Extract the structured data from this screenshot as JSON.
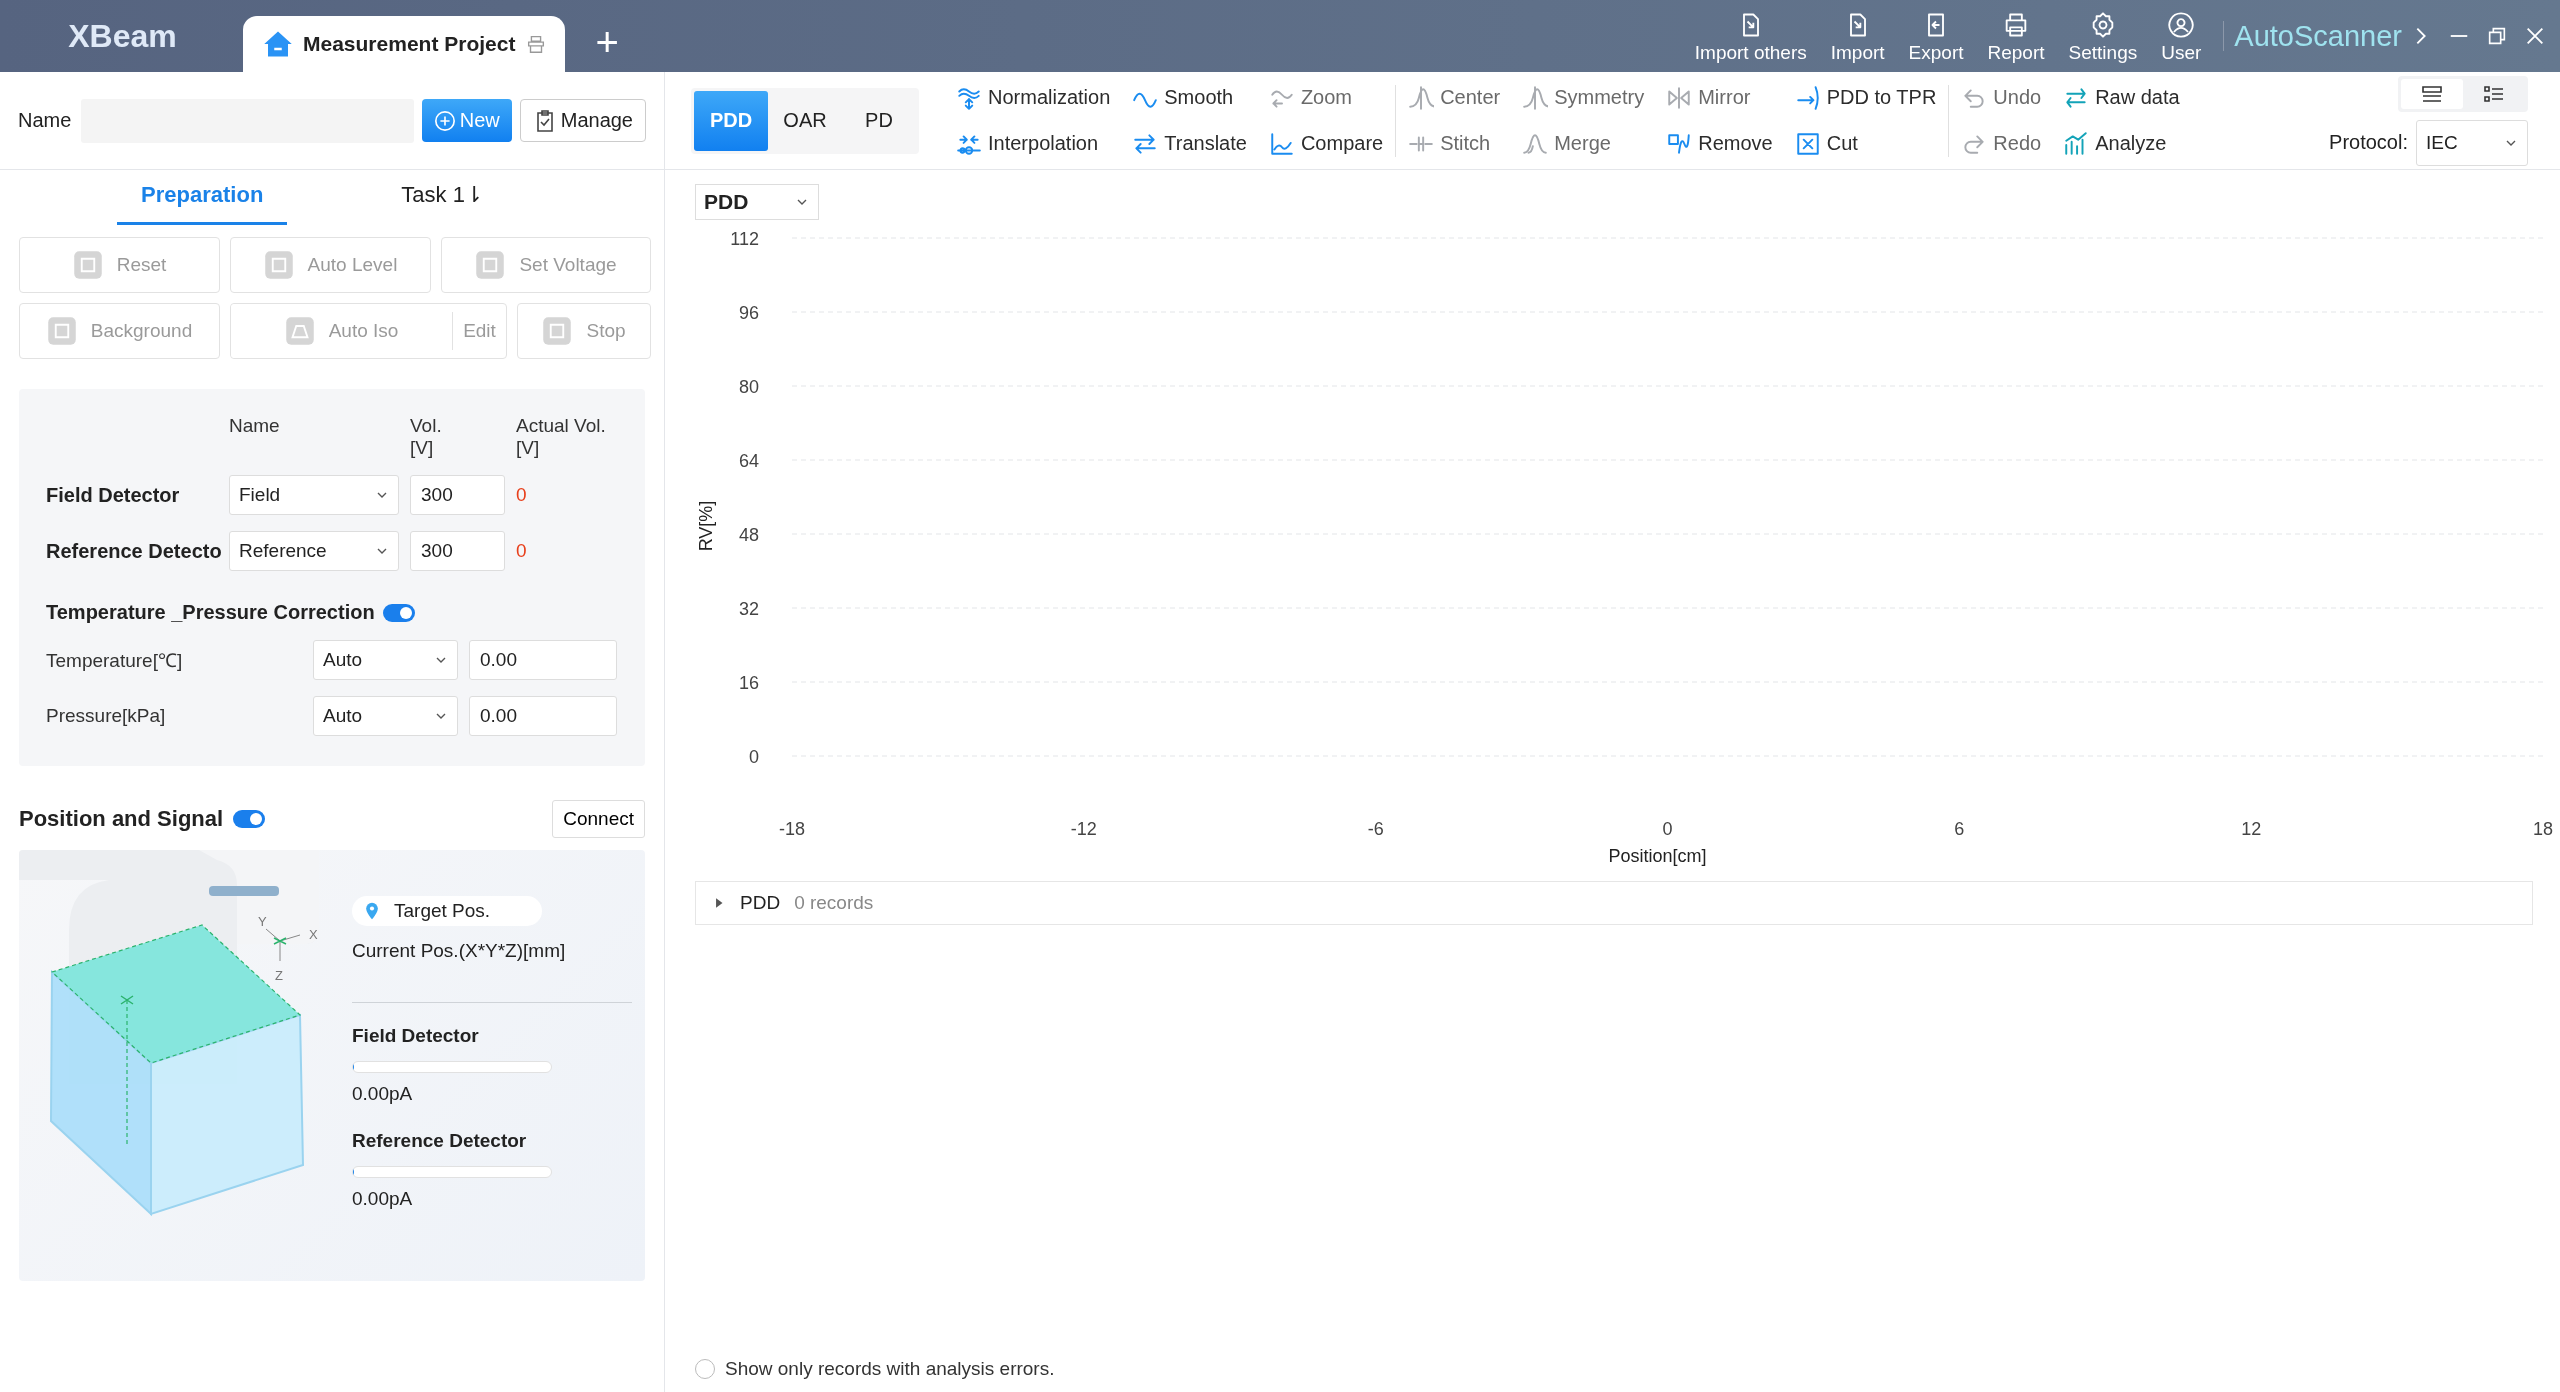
{
  "titlebar": {
    "logo": "XBeam",
    "tabs": [
      {
        "label": "Measurement Project",
        "selected": true
      }
    ],
    "add_tab": "+",
    "actions": [
      {
        "label": "Import others"
      },
      {
        "label": "Import"
      },
      {
        "label": "Export"
      },
      {
        "label": "Report"
      },
      {
        "label": "Settings"
      },
      {
        "label": "User"
      }
    ],
    "app_name": "AutoScanner"
  },
  "name_row": {
    "label": "Name",
    "buttons": [
      {
        "label": "New",
        "kind": "primary"
      },
      {
        "label": "Manage",
        "kind": "default"
      }
    ]
  },
  "left_tabs": [
    {
      "label": "Preparation",
      "selected": true
    },
    {
      "label": "Task 1⇂",
      "selected": false
    }
  ],
  "actions": [
    {
      "label": "Reset",
      "disabled": true,
      "kind": "button"
    },
    {
      "label": "Auto Level",
      "disabled": true,
      "kind": "button"
    },
    {
      "label": "Set Voltage",
      "disabled": true,
      "kind": "button"
    },
    {
      "label": "Background",
      "disabled": true,
      "kind": "button"
    },
    {
      "label": "Auto Iso",
      "disabled": true,
      "kind": "split",
      "edit_label": "Edit"
    },
    {
      "label": "Stop",
      "disabled": true,
      "kind": "button"
    }
  ],
  "detectors": {
    "columns": [
      "Name",
      "Vol.\n[V]",
      "Actual Vol.\n[V]"
    ],
    "rows": [
      {
        "label": "Field Detector",
        "name": "Field",
        "voltage": "300",
        "actual": "0"
      },
      {
        "label": "Reference Detecto",
        "name": "Reference",
        "voltage": "300",
        "actual": "0"
      }
    ],
    "correction": {
      "label": "Temperature _Pressure Correction",
      "on": true
    },
    "params": [
      {
        "label": "Temperature[℃]",
        "mode": "Auto",
        "value": "0.00"
      },
      {
        "label": "Pressure[kPa]",
        "mode": "Auto",
        "value": "0.00"
      }
    ]
  },
  "position": {
    "title": "Position and Signal",
    "on": true,
    "connect": "Connect",
    "axes": [
      "Y",
      "X",
      "Z"
    ],
    "target": "Target Pos.",
    "current": "Current Pos.(X*Y*Z)[mm]",
    "signals": [
      {
        "label": "Field Detector",
        "level": 0,
        "reading": "0.00pA"
      },
      {
        "label": "Reference Detector",
        "level": 0,
        "reading": "0.00pA"
      }
    ]
  },
  "modes": [
    {
      "label": "PDD",
      "selected": true
    },
    {
      "label": "OAR",
      "selected": false
    },
    {
      "label": "PD",
      "selected": false
    }
  ],
  "tool_groups": [
    [
      {
        "label": "Normalization",
        "disabled": false
      },
      {
        "label": "Interpolation",
        "disabled": false
      },
      {
        "label": "Smooth",
        "disabled": false
      },
      {
        "label": "Translate",
        "disabled": false
      },
      {
        "label": "Zoom",
        "disabled": true
      },
      {
        "label": "Compare",
        "disabled": false
      }
    ],
    [
      {
        "label": "Center",
        "disabled": true
      },
      {
        "label": "Stitch",
        "disabled": true
      },
      {
        "label": "Symmetry",
        "disabled": true
      },
      {
        "label": "Merge",
        "disabled": true
      },
      {
        "label": "Mirror",
        "disabled": true
      },
      {
        "label": "Remove",
        "disabled": false
      },
      {
        "label": "PDD to TPR",
        "disabled": false
      },
      {
        "label": "Cut",
        "disabled": false
      }
    ],
    [
      {
        "label": "Undo",
        "disabled": true
      },
      {
        "label": "Redo",
        "disabled": true
      },
      {
        "label": "Raw data",
        "disabled": false
      },
      {
        "label": "Analyze",
        "disabled": false
      }
    ]
  ],
  "view_toggle": [
    {
      "selected": true
    },
    {
      "selected": false
    }
  ],
  "protocol": {
    "label": "Protocol:",
    "value": "IEC"
  },
  "chart_select": "PDD",
  "chart_data": {
    "type": "line",
    "xlabel": "Position[cm]",
    "ylabel": "RV[%]",
    "xlim": [
      -18,
      18
    ],
    "ylim": [
      0,
      112
    ],
    "xticks": [
      -18,
      -12,
      -6,
      0,
      6,
      12,
      18
    ],
    "yticks": [
      0,
      16,
      32,
      48,
      64,
      80,
      96,
      112
    ],
    "grid": true
  },
  "records": {
    "name": "PDD",
    "count": "0 records",
    "expanded": false
  },
  "errors_only": {
    "label": "Show only records with analysis errors.",
    "checked": false
  }
}
